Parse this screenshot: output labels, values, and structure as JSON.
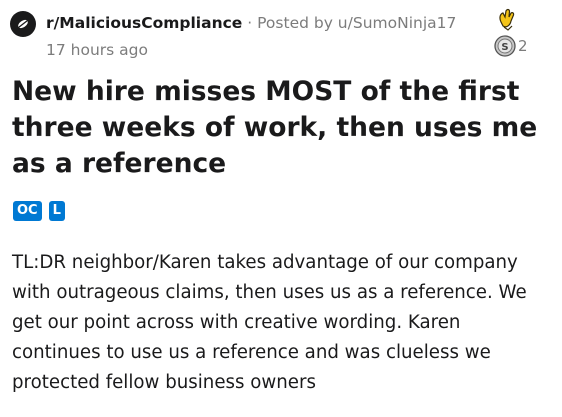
{
  "post": {
    "subreddit": "r/MaliciousCompliance",
    "separator": "·",
    "posted_by": "Posted by u/SumoNinja17",
    "time_ago": "17 hours ago",
    "title": "New hire misses MOST of the first three weeks of work, then uses me as a reference",
    "flairs": [
      "OC",
      "L"
    ],
    "body": "TL:DR neighbor/Karen takes advantage of our company with outrageous claims, then uses us as a reference. We get our point across with creative wording. Karen continues to use us a reference and was clueless we protected fellow business owners"
  },
  "awards": {
    "items": [
      "hand-wave-award-icon",
      "silver-award-icon"
    ],
    "silver_count": "2"
  },
  "colors": {
    "flair_bg": "#0079d3",
    "meta_gray": "#7c7c7c",
    "text": "#1a1a1b"
  }
}
